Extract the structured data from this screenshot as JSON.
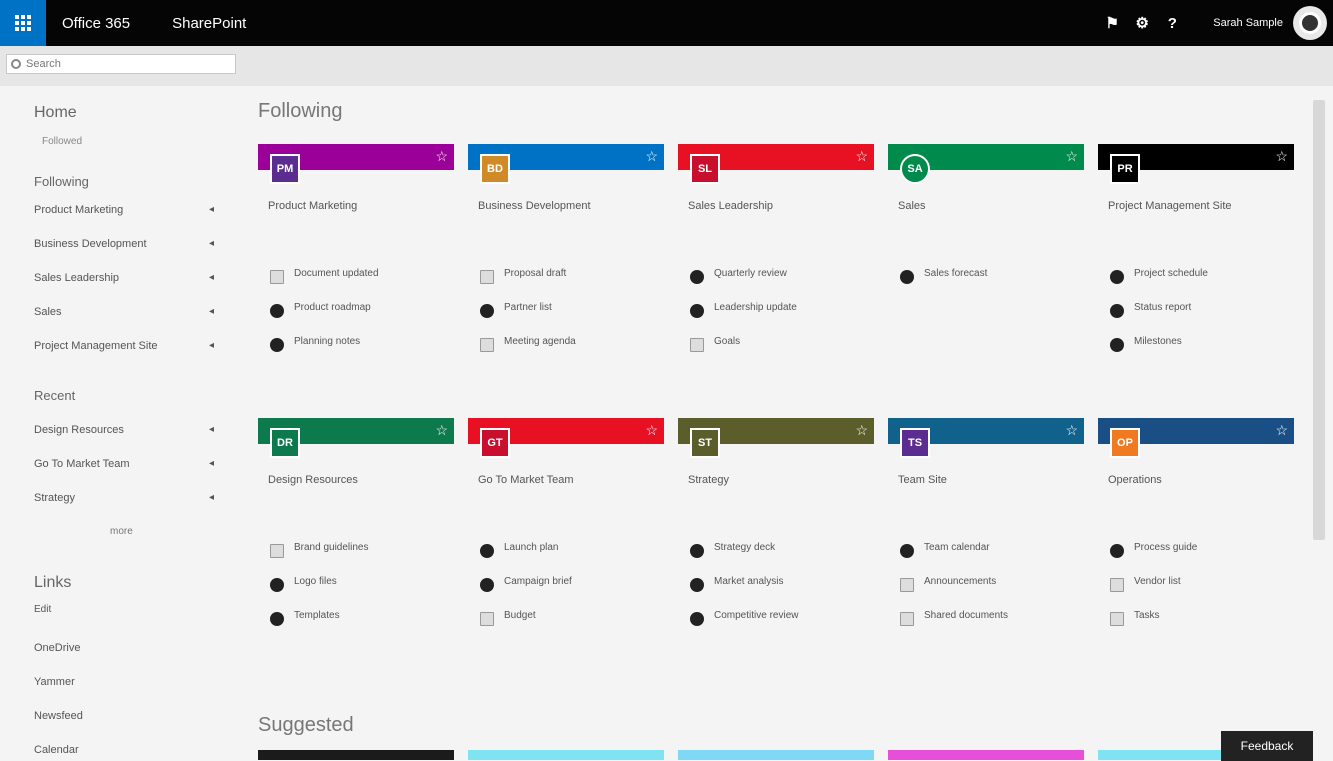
{
  "suite": {
    "brand": "Office 365",
    "app": "SharePoint",
    "username": "Sarah Sample",
    "icons": [
      "notifications-icon",
      "settings-icon",
      "help-icon"
    ]
  },
  "search": {
    "placeholder": "Search"
  },
  "nav": {
    "home": "Home",
    "home_sub": "Followed",
    "following_heading": "Following",
    "following": [
      "Product Marketing",
      "Business Development",
      "Sales Leadership",
      "Sales",
      "Project Management Site"
    ],
    "recent_heading": "Recent",
    "recent": [
      "Design Resources",
      "Go To Market Team",
      "Strategy"
    ],
    "more": "more",
    "links_heading": "Links",
    "links_sub": "Edit",
    "links": [
      "OneDrive",
      "Yammer",
      "Newsfeed",
      "Calendar"
    ]
  },
  "main": {
    "following_title": "Following",
    "suggested_title": "Suggested",
    "tiles": [
      {
        "name": "Product Marketing",
        "sub": "",
        "initials": "PM",
        "color": "#9b0098",
        "logo": "#5b2d90",
        "round": false
      },
      {
        "name": "Business Development",
        "sub": "",
        "initials": "BD",
        "color": "#0072c6",
        "logo": "#d08b28",
        "round": false
      },
      {
        "name": "Sales Leadership",
        "sub": "",
        "initials": "SL",
        "color": "#e81123",
        "logo": "#c8102e",
        "round": false
      },
      {
        "name": "Sales",
        "sub": "",
        "initials": "SA",
        "color": "#008a4b",
        "logo": "#008a4b",
        "round": true
      },
      {
        "name": "Project Management Site",
        "sub": "",
        "initials": "PR",
        "color": "#000000",
        "logo": "#000000",
        "round": false
      },
      {
        "name": "Design Resources",
        "sub": "",
        "initials": "DR",
        "color": "#0d7a4d",
        "logo": "#0d7a4d",
        "round": false
      },
      {
        "name": "Go To Market Team",
        "sub": "",
        "initials": "GT",
        "color": "#e81123",
        "logo": "#c8102e",
        "round": false
      },
      {
        "name": "Strategy",
        "sub": "",
        "initials": "ST",
        "color": "#5b5e2a",
        "logo": "#5b5e2a",
        "round": false
      },
      {
        "name": "Team Site",
        "sub": "",
        "initials": "TS",
        "color": "#11618d",
        "logo": "#5b2d90",
        "round": false
      },
      {
        "name": "Operations",
        "sub": "",
        "initials": "OP",
        "color": "#1a4f86",
        "logo": "#f07a21",
        "round": false
      }
    ],
    "activities": [
      [
        {
          "text": "Document updated",
          "by": "",
          "doc": true
        },
        {
          "text": "Product roadmap",
          "by": "",
          "doc": false
        },
        {
          "text": "Planning notes",
          "by": "",
          "doc": false
        }
      ],
      [
        {
          "text": "Proposal draft",
          "by": "",
          "doc": true
        },
        {
          "text": "Partner list",
          "by": "",
          "doc": false
        },
        {
          "text": "Meeting agenda",
          "by": "",
          "doc": true
        }
      ],
      [
        {
          "text": "Quarterly review",
          "by": "",
          "doc": false
        },
        {
          "text": "Leadership update",
          "by": "",
          "doc": false
        },
        {
          "text": "Goals",
          "by": "",
          "doc": true
        }
      ],
      [
        {
          "text": "Sales forecast",
          "by": "",
          "doc": false
        }
      ],
      [
        {
          "text": "Project schedule",
          "by": "",
          "doc": false
        },
        {
          "text": "Status report",
          "by": "",
          "doc": false
        },
        {
          "text": "Milestones",
          "by": "",
          "doc": false
        }
      ],
      [
        {
          "text": "Brand guidelines",
          "by": "",
          "doc": true
        },
        {
          "text": "Logo files",
          "by": "",
          "doc": false
        },
        {
          "text": "Templates",
          "by": "",
          "doc": false
        }
      ],
      [
        {
          "text": "Launch plan",
          "by": "",
          "doc": false
        },
        {
          "text": "Campaign brief",
          "by": "",
          "doc": false
        },
        {
          "text": "Budget",
          "by": "",
          "doc": true
        }
      ],
      [
        {
          "text": "Strategy deck",
          "by": "",
          "doc": false
        },
        {
          "text": "Market analysis",
          "by": "",
          "doc": false
        },
        {
          "text": "Competitive review",
          "by": "",
          "doc": false
        }
      ],
      [
        {
          "text": "Team calendar",
          "by": "",
          "doc": false
        },
        {
          "text": "Announcements",
          "by": "",
          "doc": true
        },
        {
          "text": "Shared documents",
          "by": "",
          "doc": true
        }
      ],
      [
        {
          "text": "Process guide",
          "by": "",
          "doc": false
        },
        {
          "text": "Vendor list",
          "by": "",
          "doc": true
        },
        {
          "text": "Tasks",
          "by": "",
          "doc": true
        }
      ]
    ],
    "suggested_colors": [
      "#1b1b1b",
      "#7fe3f2",
      "#7fd8f5",
      "#e84fd8",
      "#7fe3f2"
    ]
  },
  "feedback": "Feedback"
}
